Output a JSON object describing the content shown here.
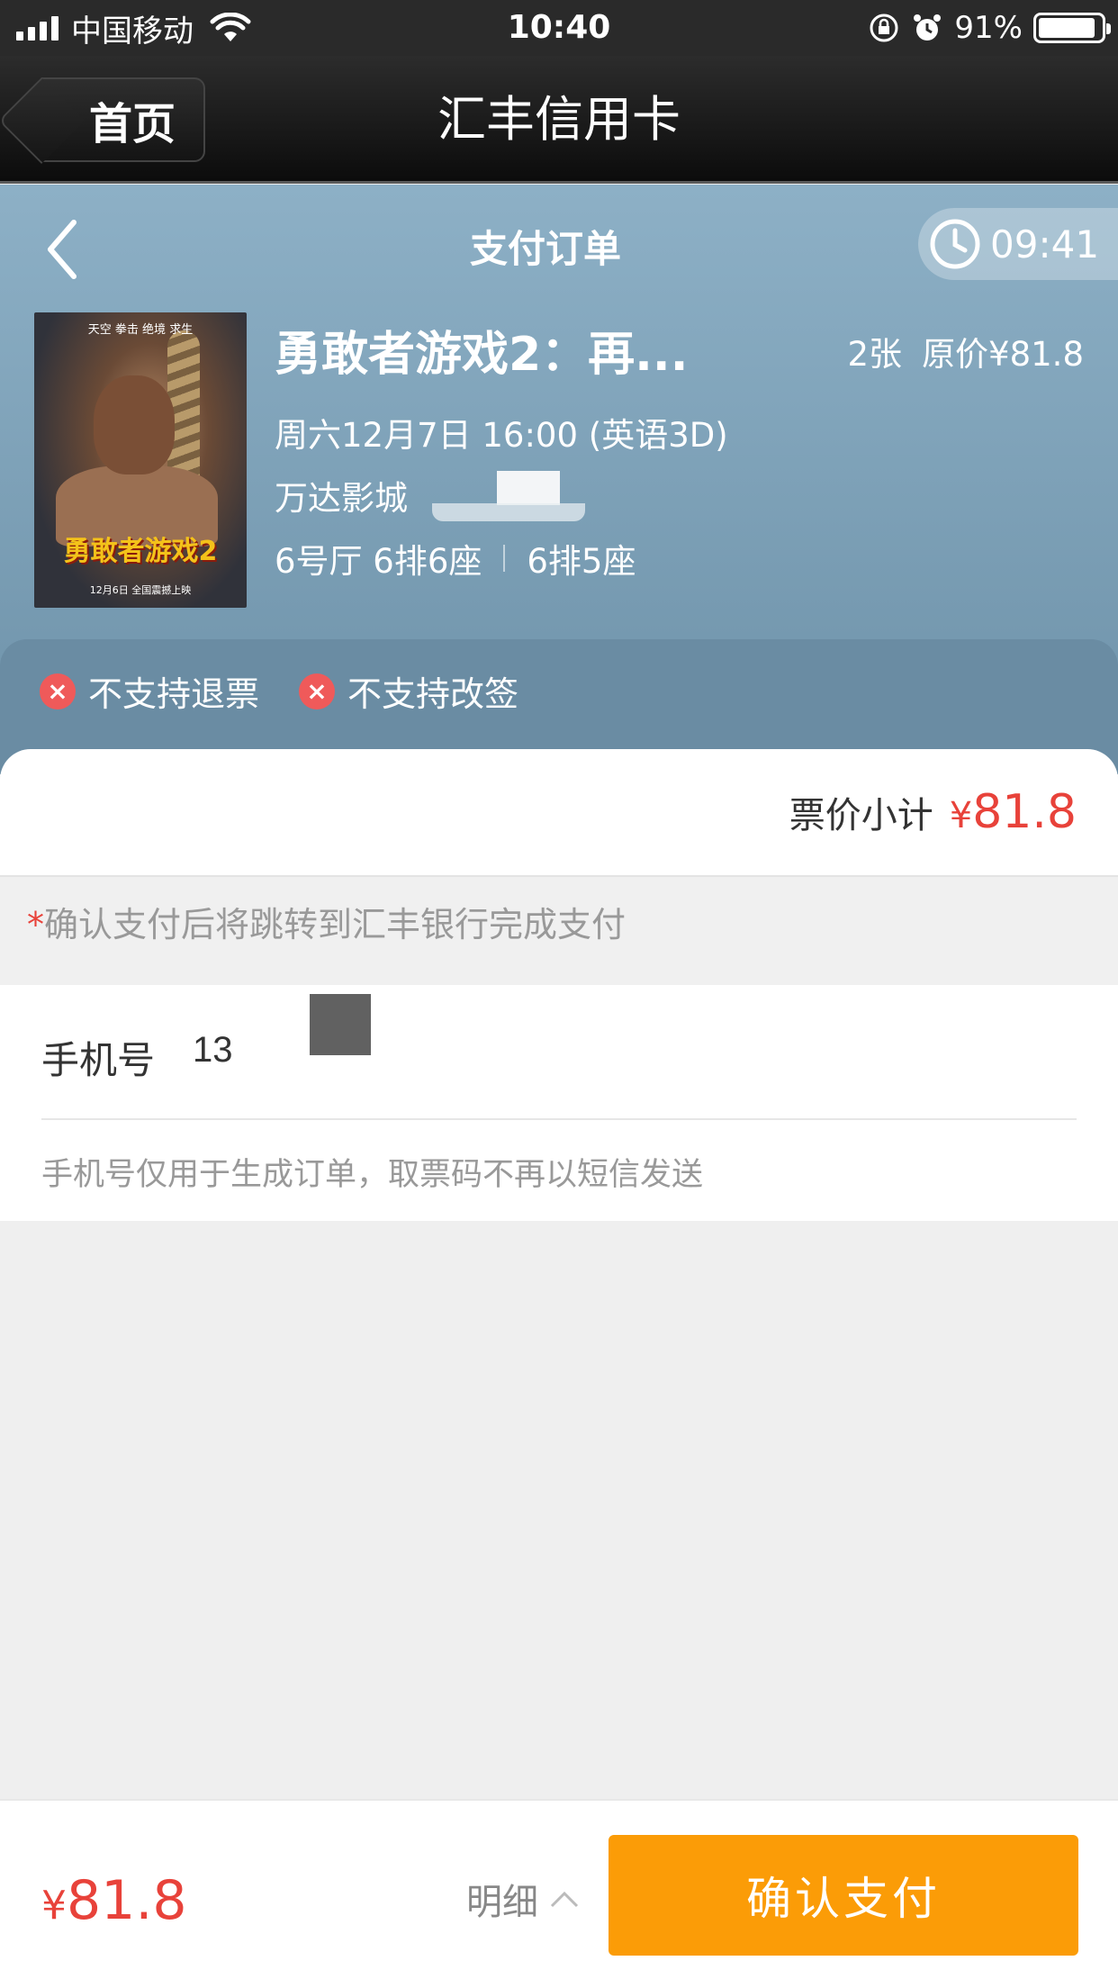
{
  "status_bar": {
    "carrier": "中国移动",
    "time": "10:40",
    "battery_percent": "91%",
    "battery_level": 0.91
  },
  "app_nav": {
    "back_label": "首页",
    "title": "汇丰信用卡"
  },
  "header": {
    "title": "支付订单",
    "countdown": "09:41"
  },
  "movie": {
    "title": "勇敢者游戏2：再...",
    "ticket_count": "2张",
    "original_price": "原价¥81.8",
    "showtime": "周六12月7日 16:00 (英语3D)",
    "cinema": "万达影城",
    "hall_seat_1": "6号厅 6排6座",
    "seat_2": "6排5座",
    "poster": {
      "top_text": "天空  拳击  绝境  求生",
      "title_text": "勇敢者游戏2",
      "bottom_text": "12月6日 全国震撼上映"
    }
  },
  "notices": [
    {
      "icon": "close-icon",
      "label": "不支持退票"
    },
    {
      "icon": "close-icon",
      "label": "不支持改签"
    }
  ],
  "subtotal": {
    "label": "票价小计",
    "currency": "¥",
    "amount": "81.8"
  },
  "tip": {
    "star": "*",
    "text": "确认支付后将跳转到汇丰银行完成支付"
  },
  "phone": {
    "label": "手机号",
    "value": "13",
    "note": "手机号仅用于生成订单，取票码不再以短信发送"
  },
  "footer": {
    "currency": "¥",
    "total": "81.8",
    "detail_label": "明细",
    "confirm_label": "确认支付"
  },
  "colors": {
    "accent_red": "#e8423a",
    "confirm_orange": "#fb9c07",
    "header_blue": "#7fa2b9"
  }
}
